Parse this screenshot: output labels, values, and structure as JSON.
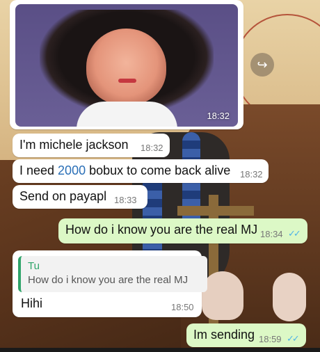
{
  "chat": {
    "photo_message": {
      "time": "18:32"
    },
    "messages": [
      {
        "text": "I'm michele jackson",
        "time": "18:32"
      },
      {
        "text_before": "I need ",
        "text_number": "2000",
        "text_after": " bobux to come back alive",
        "time": "18:32"
      },
      {
        "text": "Send on payapl",
        "time": "18:33"
      },
      {
        "text": "How do i know you are the real MJ",
        "time": "18:34",
        "ticks": "✓✓"
      },
      {
        "reply_name": "Tu",
        "reply_text": "How do i know you are the real MJ",
        "text": "Hihi",
        "time": "18:50"
      },
      {
        "text": "Im sending",
        "time": "18:59",
        "ticks": "✓✓"
      }
    ]
  },
  "icons": {
    "forward": "forward-icon",
    "read_receipt": "double-check-icon"
  },
  "colors": {
    "incoming": "#ffffff",
    "outgoing": "#dcf8c6",
    "read_ticks": "#4fb3e6",
    "reply_accent": "#2fa46a"
  }
}
